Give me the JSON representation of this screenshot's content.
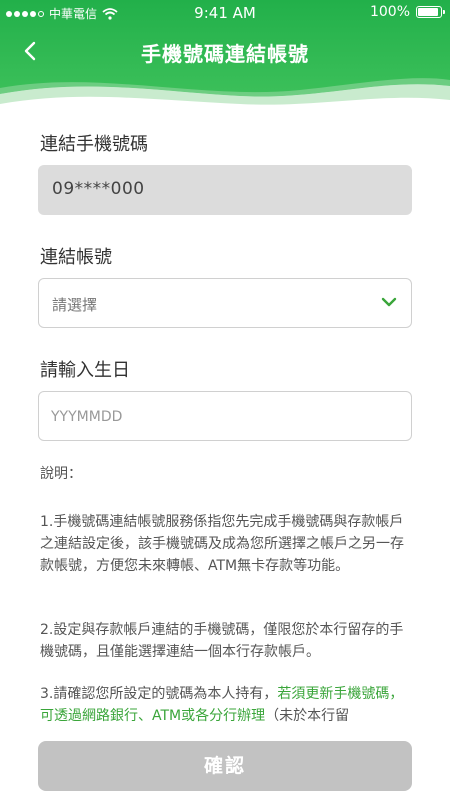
{
  "status_bar": {
    "carrier": "中華電信",
    "time": "9:41 AM",
    "battery": "100%"
  },
  "nav": {
    "title": "手機號碼連結帳號",
    "back_icon": "chevron-left-icon"
  },
  "form": {
    "phone_label": "連結手機號碼",
    "phone_value": "09****000",
    "account_label": "連結帳號",
    "account_placeholder": "請選擇",
    "birthday_label": "請輸入生日",
    "birthday_placeholder": "YYYMMDD"
  },
  "description": {
    "heading": "說明：",
    "p1": "1.手機號碼連結帳號服務係指您先完成手機號碼與存款帳戶之連結設定後，該手機號碼及成為您所選擇之帳戶之另一存款帳號，方便您未來轉帳、ATM無卡存款等功能。",
    "p2": "2.設定與存款帳戶連結的手機號碼，僅限您於本行留存的手機號碼，且僅能選擇連結一個本行存款帳戶。",
    "p3_a": "3.請確認您所設定的號碼為本人持有，",
    "p3_green": "若須更新手機號碼，可透過網路銀行、ATM或各分行辦理",
    "p3_b": "（未於本行留"
  },
  "confirm_label": "確認",
  "colors": {
    "header_green": "#2ab64a",
    "accent_green": "#3aa53a",
    "disabled_button": "#c2c2c2"
  }
}
